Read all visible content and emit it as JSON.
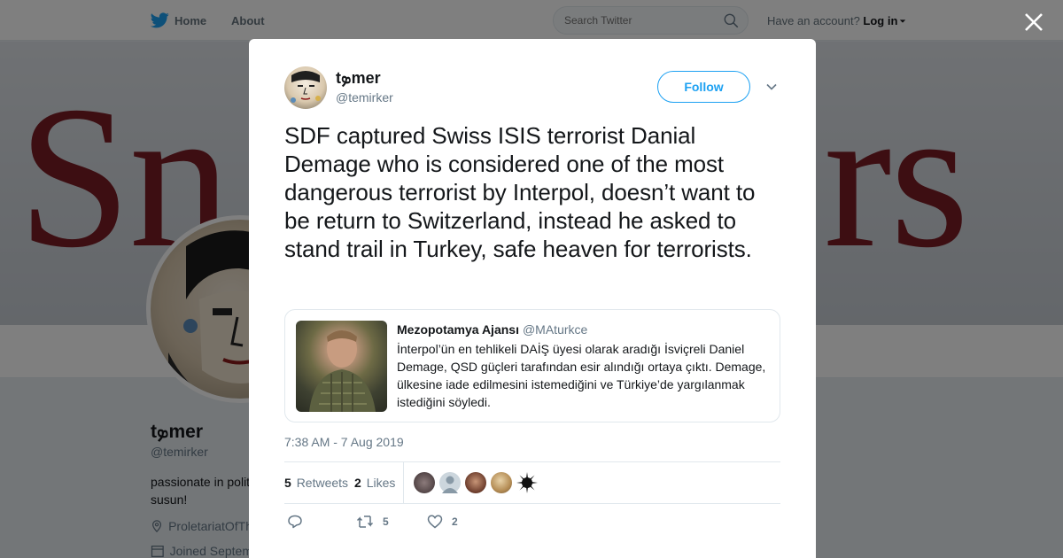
{
  "topbar": {
    "home_label": "Home",
    "about_label": "About",
    "search_placeholder": "Search Twitter",
    "account_prompt": "Have an account?",
    "login_label": "Log in"
  },
  "banner": {
    "left_text": "Sn",
    "right_text": "rs"
  },
  "profile": {
    "name": "tܤmer",
    "handle": "@temirker",
    "bio": "passionate in polit susun!",
    "location": "ProletariatOfTh",
    "joined": "Joined Septem"
  },
  "tweet": {
    "author_name": "tܤmer",
    "author_handle": "@temirker",
    "follow_label": "Follow",
    "text": "SDF captured Swiss ISIS terrorist Danial Demage who is considered one of the most dangerous terrorist by Interpol, doesn’t want to be return to Switzerland, instead he asked to stand trail in Turkey, safe heaven for terrorists.",
    "quote": {
      "name": "Mezopotamya Ajansı",
      "handle": "@MAturkce",
      "text": "İnterpol’ün en tehlikeli DAİŞ üyesi olarak aradığı İsviçreli Daniel Demage, QSD güçleri tarafından esir alındığı ortaya çıktı. Demage, ülkesine iade edilmesini istemediğini ve Türkiye’de yargılanmak istediğini söyledi."
    },
    "timestamp": "7:38 AM - 7 Aug 2019",
    "retweets_count": "5",
    "retweets_label": "Retweets",
    "likes_count": "2",
    "likes_label": "Likes",
    "action_retweets": "5",
    "action_likes": "2"
  },
  "colors": {
    "accent": "#1da1f2",
    "text": "#14171a",
    "muted": "#657786",
    "banner_red": "#7a1c24"
  },
  "icons": [
    "twitter-bird-icon",
    "search-icon",
    "caret-down-icon",
    "close-icon",
    "reply-icon",
    "retweet-icon",
    "heart-icon",
    "location-pin-icon",
    "calendar-icon"
  ]
}
